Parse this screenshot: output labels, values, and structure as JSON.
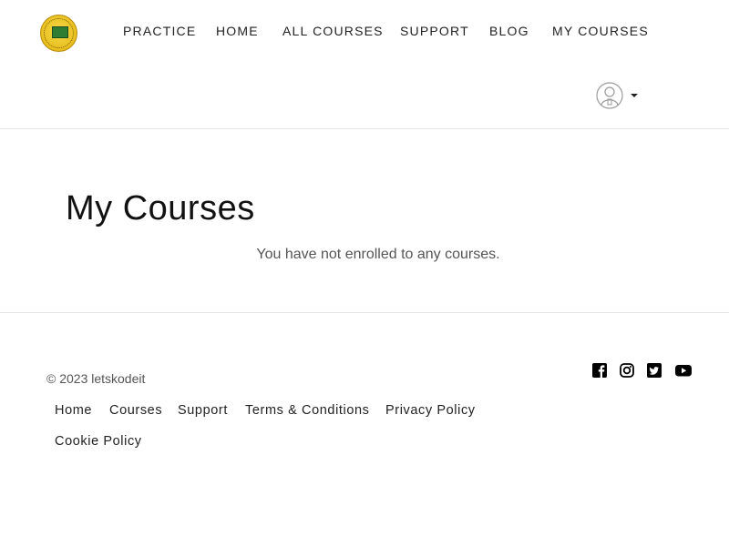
{
  "header": {
    "logo_icon": "letskodeit-logo",
    "nav": [
      {
        "label": "PRACTICE"
      },
      {
        "label": "HOME"
      },
      {
        "label": "ALL COURSES"
      },
      {
        "label": "SUPPORT"
      },
      {
        "label": "BLOG"
      },
      {
        "label": "MY COURSES"
      }
    ],
    "user_menu_icon": "user-avatar-icon"
  },
  "main": {
    "title": "My Courses",
    "empty_message": "You have not enrolled to any courses."
  },
  "footer": {
    "copyright": "© 2023 letskodeit",
    "links": [
      {
        "label": "Home"
      },
      {
        "label": "Courses"
      },
      {
        "label": "Support"
      },
      {
        "label": "Terms & Conditions"
      },
      {
        "label": "Privacy Policy"
      },
      {
        "label": "Cookie Policy"
      }
    ],
    "social_icons": [
      "facebook-icon",
      "instagram-icon",
      "twitter-icon",
      "youtube-icon"
    ]
  }
}
